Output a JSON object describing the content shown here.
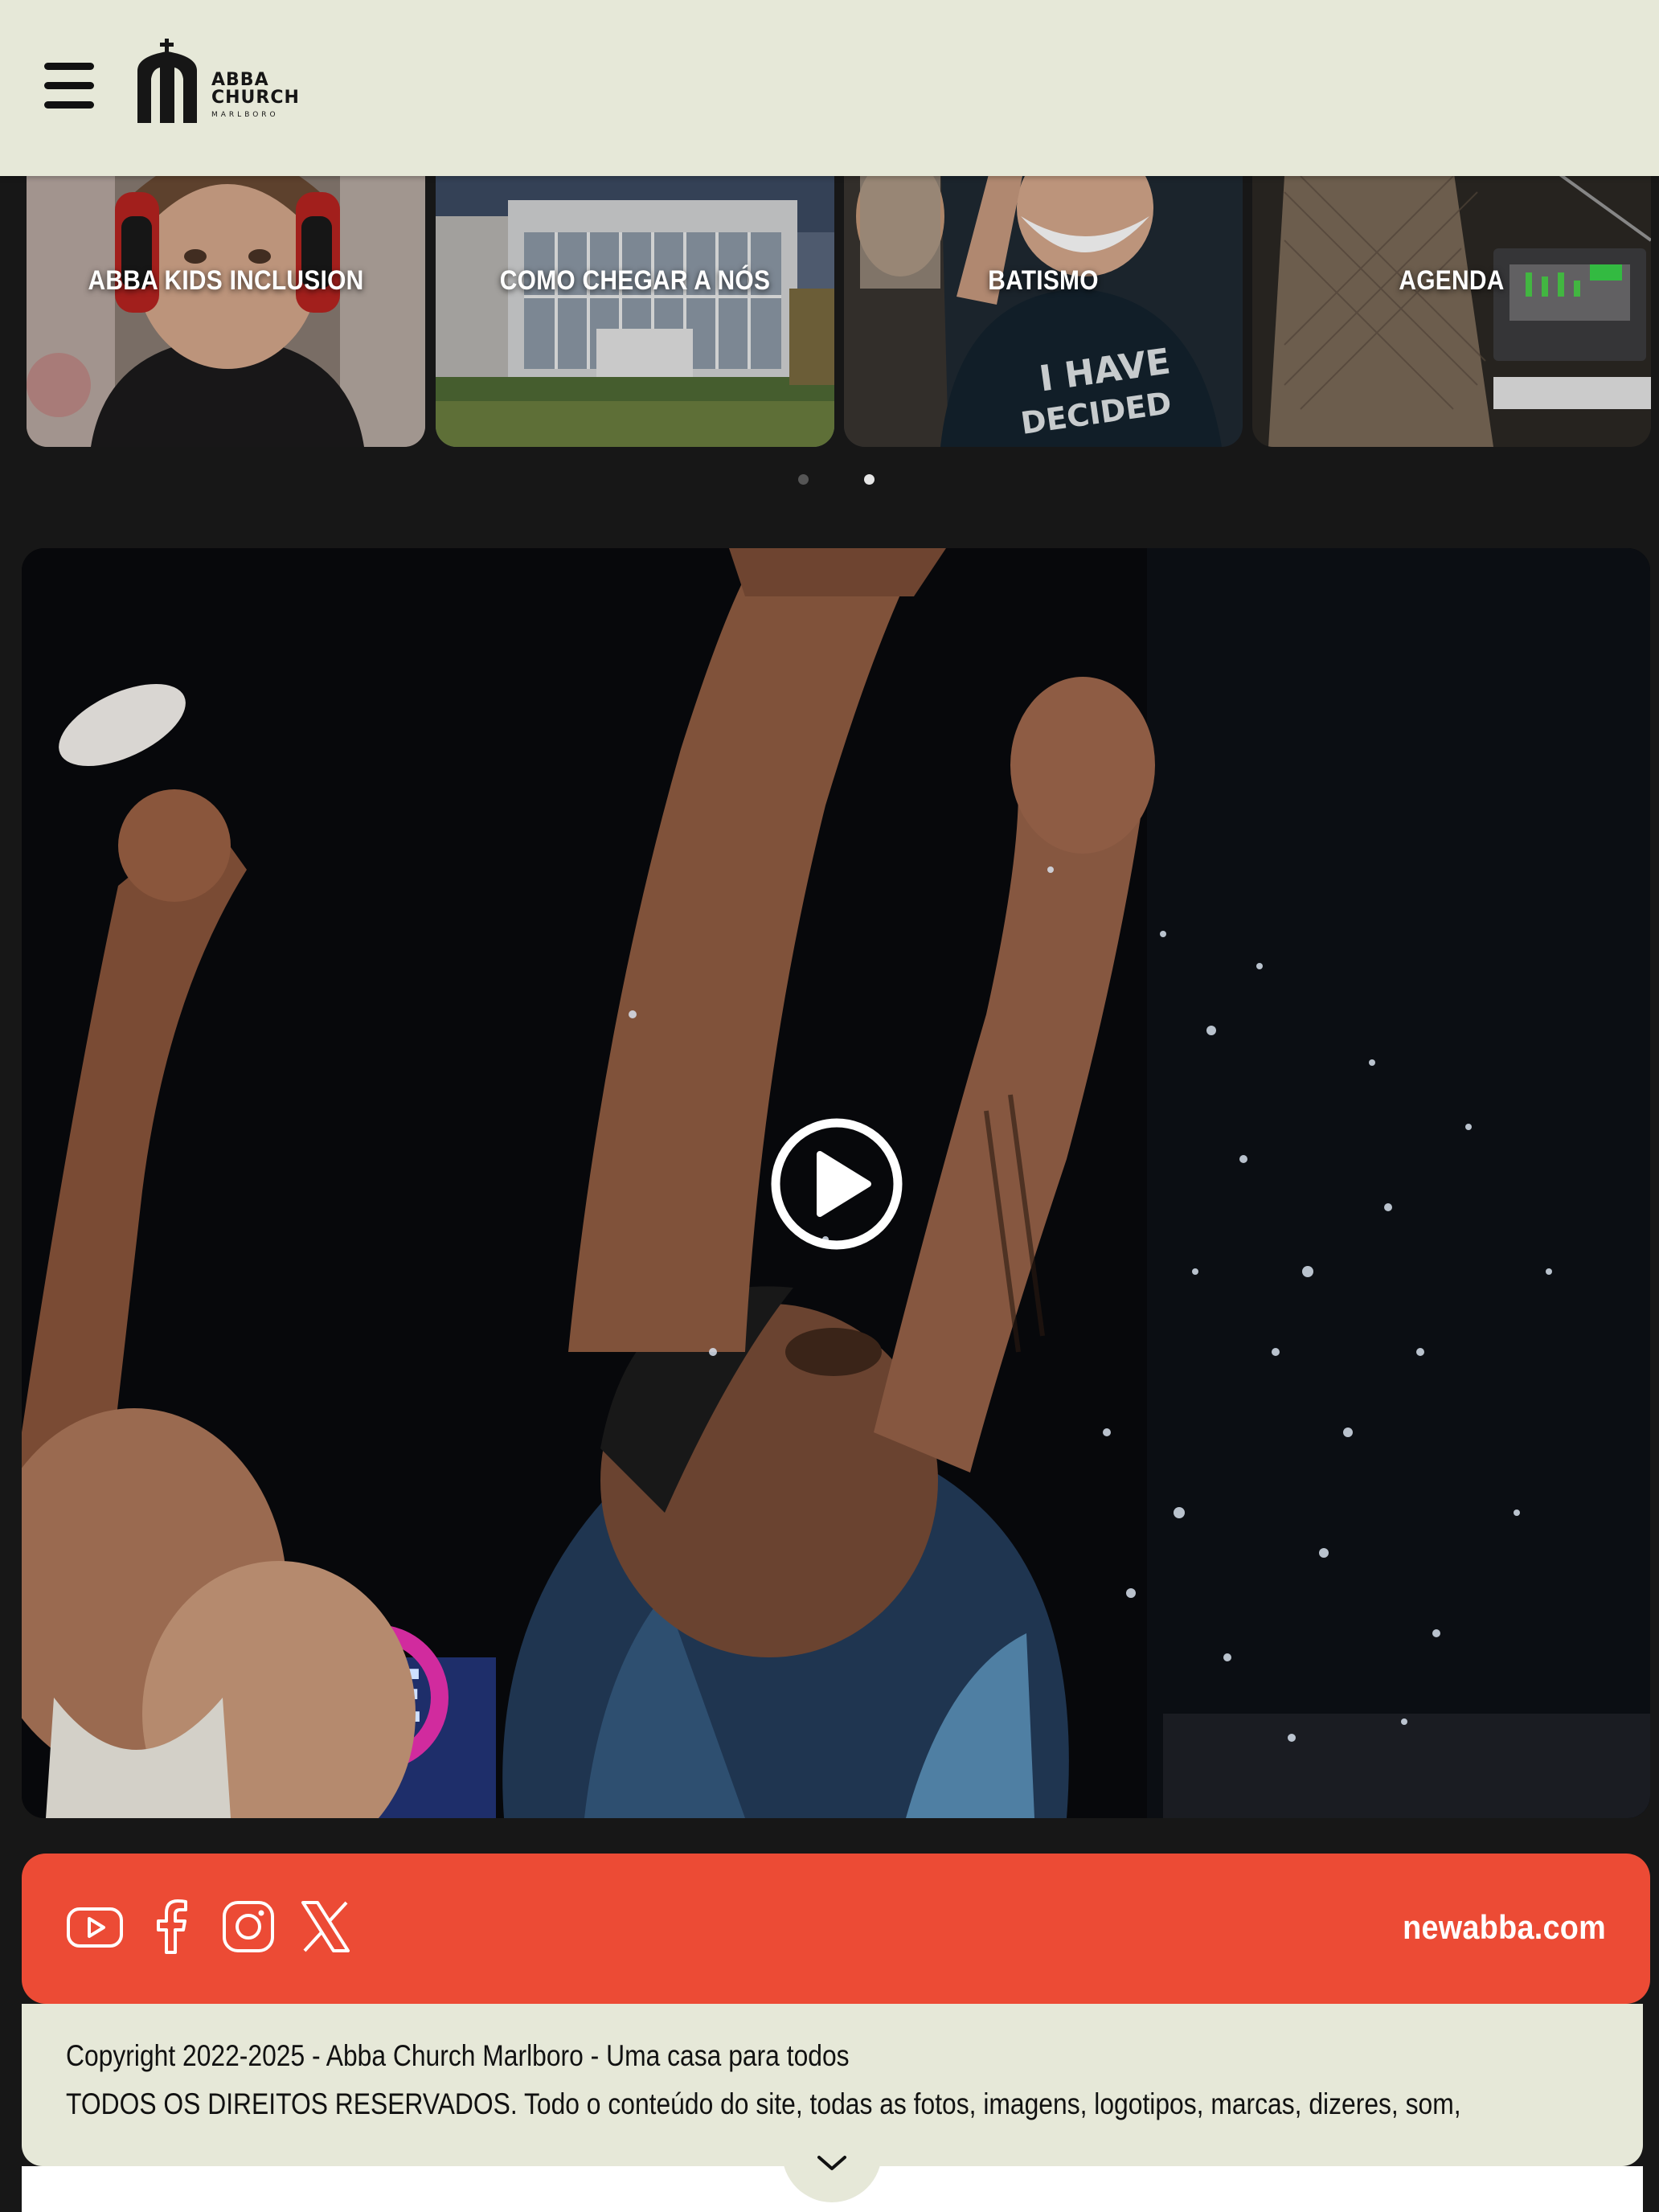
{
  "header": {
    "menu_icon": "hamburger-menu-icon",
    "logo": {
      "line1": "ABBA",
      "line2": "CHURCH",
      "line3": "MARLBORO"
    }
  },
  "carousel": {
    "cards": [
      {
        "label": "ABBA KIDS INCLUSION"
      },
      {
        "label": "COMO CHEGAR A NÓS"
      },
      {
        "label": "BATISMO"
      },
      {
        "label": "AGENDA"
      }
    ],
    "pages": 2,
    "active_page": 2
  },
  "video": {
    "play_icon": "play-icon"
  },
  "social": {
    "icons": [
      "youtube-icon",
      "facebook-icon",
      "instagram-icon",
      "x-icon"
    ],
    "site": "newabba.com"
  },
  "footer": {
    "copyright": "Copyright 2022-2025 - Abba Church Marlboro - Uma casa para todos",
    "rights": "TODOS OS DIREITOS RESERVADOS. Todo o conteúdo do site, todas as fotos, imagens, logotipos, marcas, dizeres, som,"
  },
  "colors": {
    "header_bg": "#e6e8d8",
    "page_bg": "#171717",
    "social_bar": "#ec4b35",
    "text_dark": "#111111"
  }
}
